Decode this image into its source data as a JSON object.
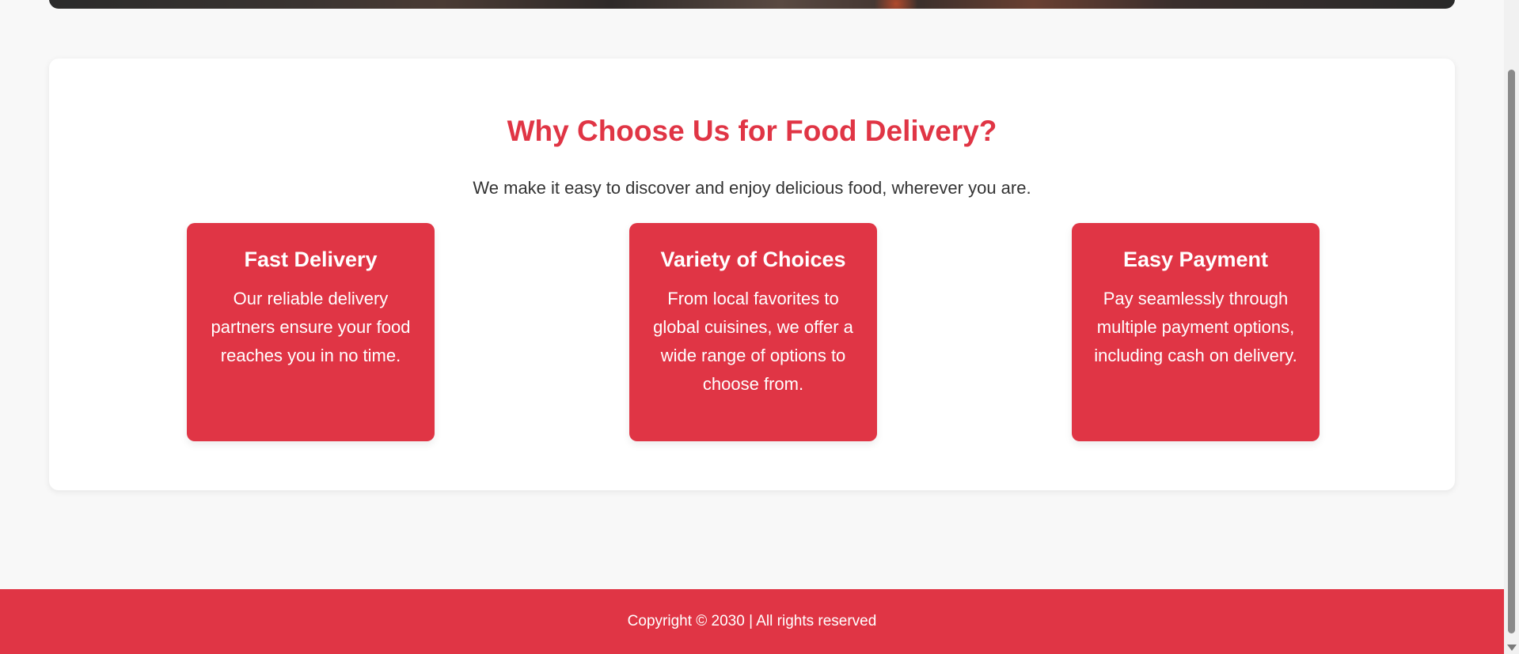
{
  "why_section": {
    "title": "Why Choose Us for Food Delivery?",
    "subtitle": "We make it easy to discover and enjoy delicious food, wherever you are.",
    "features": [
      {
        "title": "Fast Delivery",
        "text": "Our reliable delivery partners ensure your food reaches you in no time."
      },
      {
        "title": "Variety of Choices",
        "text": "From local favorites to global cuisines, we offer a wide range of options to choose from."
      },
      {
        "title": "Easy Payment",
        "text": "Pay seamlessly through multiple payment options, including cash on delivery."
      }
    ]
  },
  "footer": {
    "copyright": "Copyright © 2030 | All rights reserved"
  },
  "colors": {
    "accent": "#e03545",
    "background": "#f8f8f8",
    "card": "#ffffff",
    "text": "#333333"
  },
  "icons": {
    "scroll_down": "chevron-down-icon"
  }
}
